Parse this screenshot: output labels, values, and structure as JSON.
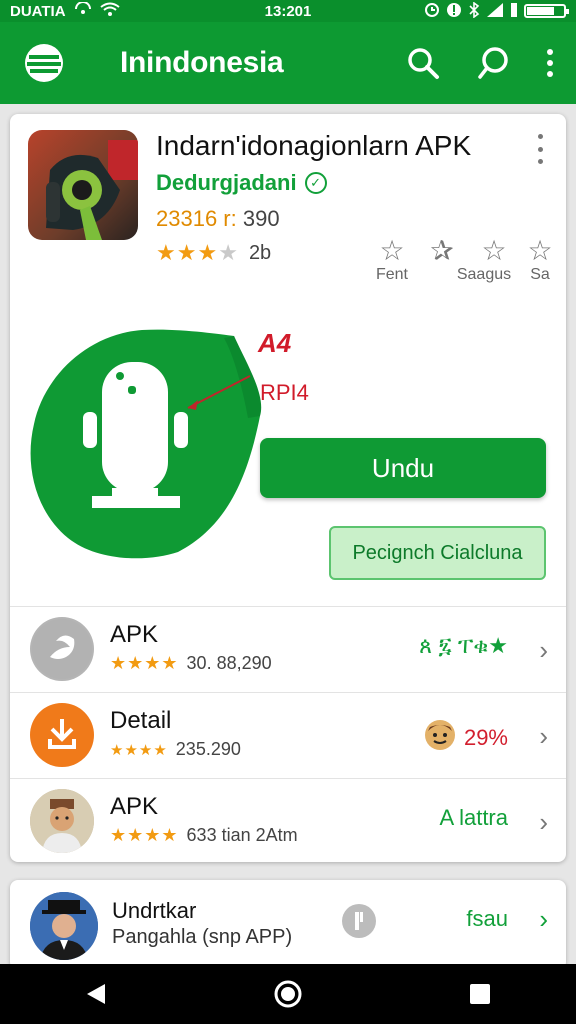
{
  "status_bar": {
    "carrier": "DUATIA",
    "time": "13:201"
  },
  "app_bar": {
    "title": "Inindonesia"
  },
  "app": {
    "title": "Indarn'idonagionlarn APK",
    "developer": "Dedurgjadani",
    "meta_price": "23316 r:",
    "meta_count": "390",
    "rating_value": "2b",
    "stars_filled": 3,
    "stars_total": 4
  },
  "rate_options": [
    {
      "label": "Fent"
    },
    {
      "label": ""
    },
    {
      "label": "Saagus"
    },
    {
      "label": "Sa"
    }
  ],
  "hero": {
    "label_a": "A4",
    "label_b": "RPI4"
  },
  "buttons": {
    "primary": "Undu",
    "secondary": "Pecignch Cialcluna"
  },
  "list": [
    {
      "title": "APK",
      "stars": "★★★★",
      "sub": "30. 88,290",
      "right": "ጰ ፯ ፐቁ★",
      "right_color": "green"
    },
    {
      "title": "Detail",
      "stars": "★★★★",
      "sub": "235.290",
      "right": "29%",
      "right_color": "red"
    },
    {
      "title": "APK",
      "stars": "★★★★",
      "sub": "633 tian 2Atm",
      "right": "A lattra",
      "right_color": "green"
    }
  ],
  "bottom_card": {
    "title": "Undrtkar",
    "subtitle": "Pangahla (snp APP)",
    "right": "fsau"
  },
  "colors": {
    "primary": "#0d9a32",
    "accent_text": "#12a03a",
    "star": "#f29b12",
    "alert": "#d11b2a"
  }
}
